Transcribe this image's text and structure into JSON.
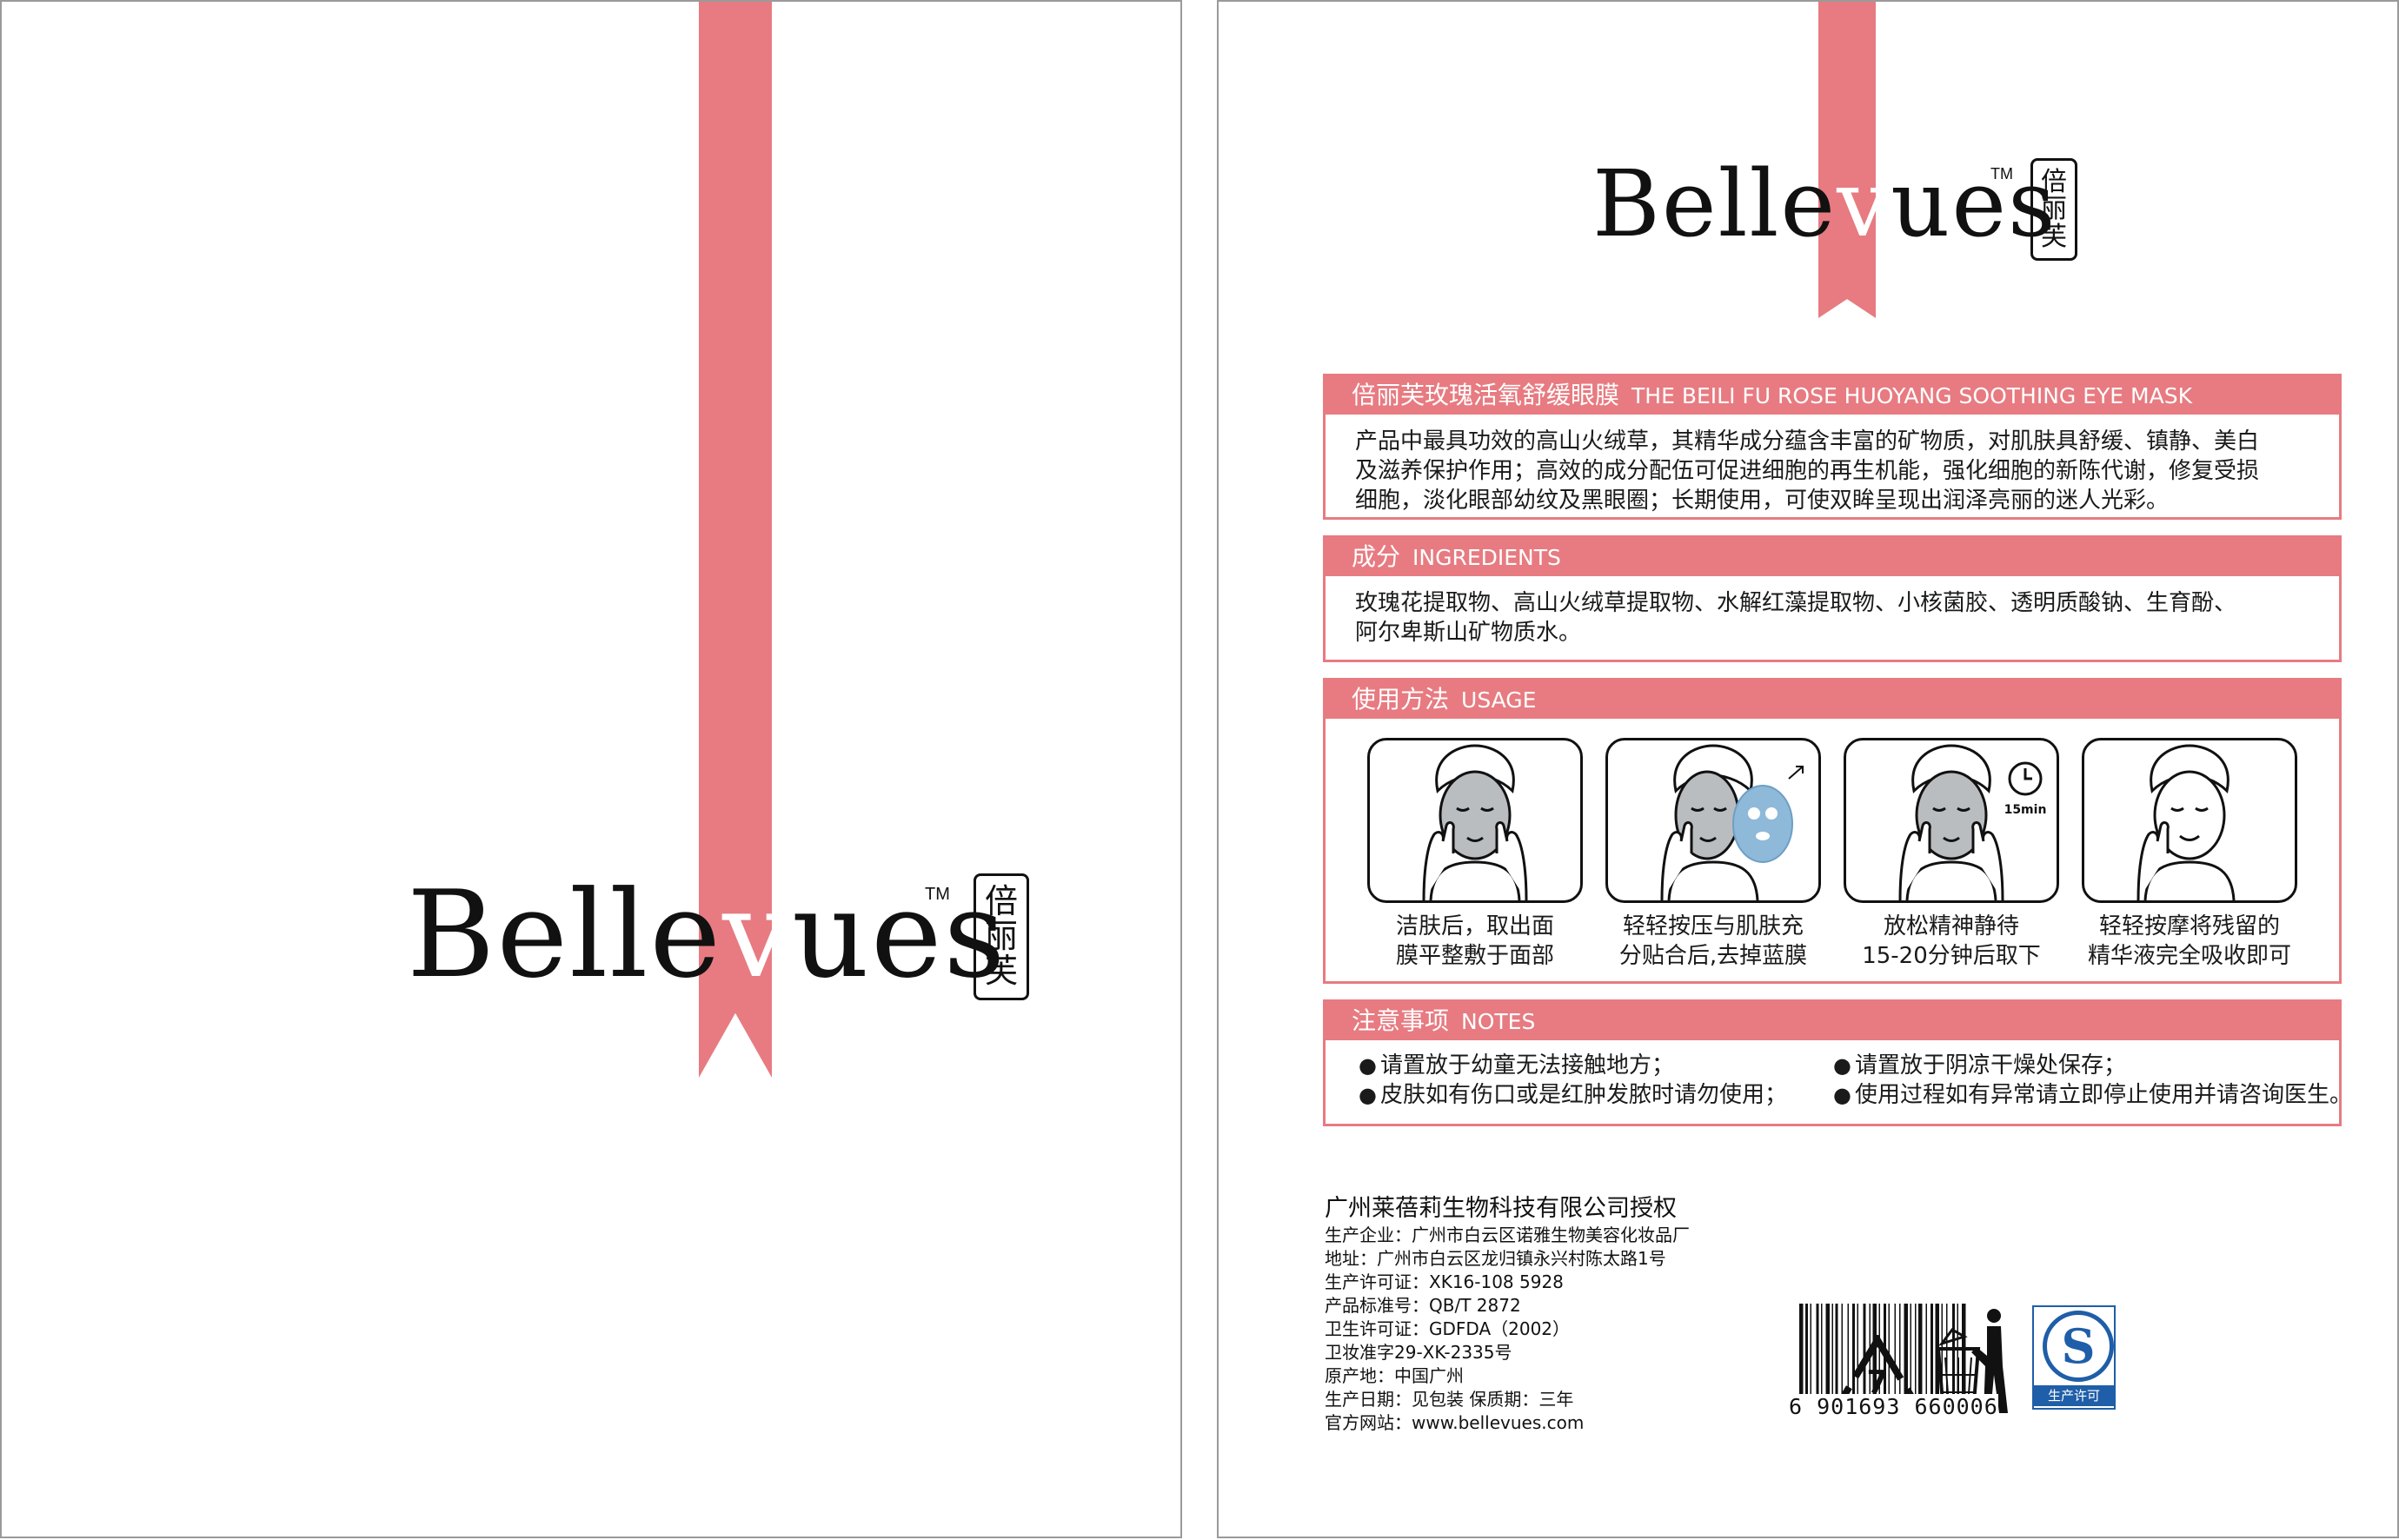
{
  "brand": {
    "name_parts": [
      "Belle",
      "v",
      "ues"
    ],
    "tm": "TM",
    "seal_chars": [
      "倍",
      "丽",
      "芙"
    ],
    "ribbon_color": "#e77b81"
  },
  "product": {
    "title_cn": "倍丽芙玫瑰活氧舒缓眼膜",
    "title_en": "THE BEILI FU ROSE HUOYANG SOOTHING EYE MASK",
    "description": [
      "产品中最具功效的高山火绒草，其精华成分蕴含丰富的矿物质，对肌肤具舒缓、镇静、美白",
      "及滋养保护作用；高效的成分配伍可促进细胞的再生机能，强化细胞的新陈代谢，修复受损",
      "细胞，淡化眼部幼纹及黑眼圈；长期使用，可使双眸呈现出润泽亮丽的迷人光彩。"
    ]
  },
  "ingredients": {
    "title_cn": "成分",
    "title_en": "INGREDIENTS",
    "lines": [
      "玫瑰花提取物、高山火绒草提取物、水解红藻提取物、小核菌胶、透明质酸钠、生育酚、",
      "阿尔卑斯山矿物质水。"
    ]
  },
  "usage": {
    "title_cn": "使用方法",
    "title_en": "USAGE",
    "timer_label": "15min",
    "steps": [
      {
        "line1": "洁肤后，取出面",
        "line2": "膜平整敷于面部",
        "icon": "face-mask-apply-icon"
      },
      {
        "line1": "轻轻按压与肌肤充",
        "line2": "分贴合后,去掉蓝膜",
        "icon": "face-mask-peel-icon"
      },
      {
        "line1": "放松精神静待",
        "line2": "15-20分钟后取下",
        "icon": "face-mask-wait-icon"
      },
      {
        "line1": "轻轻按摩将残留的",
        "line2": "精华液完全吸收即可",
        "icon": "face-massage-icon"
      }
    ]
  },
  "notes": {
    "title_cn": "注意事项",
    "title_en": "NOTES",
    "bullet": "●",
    "items": [
      "请置放于幼童无法接触地方；",
      "请置放于阴凉干燥处保存；",
      "皮肤如有伤口或是红肿发脓时请勿使用；",
      "使用过程如有异常请立即停止使用并请咨询医生。"
    ]
  },
  "company": {
    "authorized": "广州莱蓓莉生物科技有限公司授权",
    "info": [
      "生产企业：广州市白云区诺雅生物美容化妆品厂",
      "地址：广州市白云区龙归镇永兴村陈太路1号",
      "生产许可证：XK16-108  5928",
      "产品标准号：QB/T  2872",
      "卫生许可证：GDFDA（2002）",
      "卫妆准字29-XK-2335号",
      "原产地：中国广州",
      "生产日期：见包装      保质期：三年",
      "官方网站：www.bellevues.com"
    ]
  },
  "marks": {
    "recycle_number": "7",
    "qs_letter": "S",
    "qs_label": "生产许可",
    "barcode": "6 901693 660006"
  }
}
